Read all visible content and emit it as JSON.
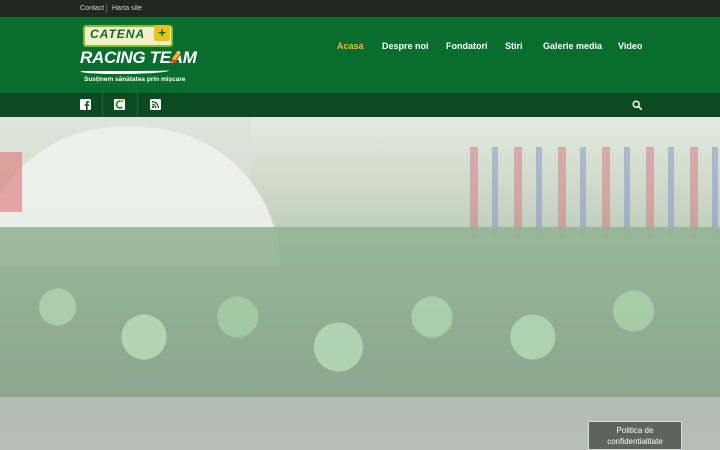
{
  "topbar": {
    "links": [
      "Contact",
      "Harta site"
    ]
  },
  "logo": {
    "badge": "CATENA",
    "plus": "+",
    "title": "RACING TEAM",
    "tagline": "Susținem sănătatea prin mișcare"
  },
  "nav": {
    "items": [
      "Acasa",
      "Despre noi",
      "Fondatori",
      "Stiri",
      "Galerie media",
      "Video"
    ],
    "active": "Acasa"
  },
  "social": {
    "icons": [
      "facebook-icon",
      "catena-icon",
      "rss-icon"
    ],
    "search": "search-icon"
  },
  "cookie": {
    "label": "Politica de confidentialitate"
  },
  "colors": {
    "topbar": "#202622",
    "header": "#096d2e",
    "socialbar": "#0c4a22",
    "active_nav": "#e6c22a"
  }
}
